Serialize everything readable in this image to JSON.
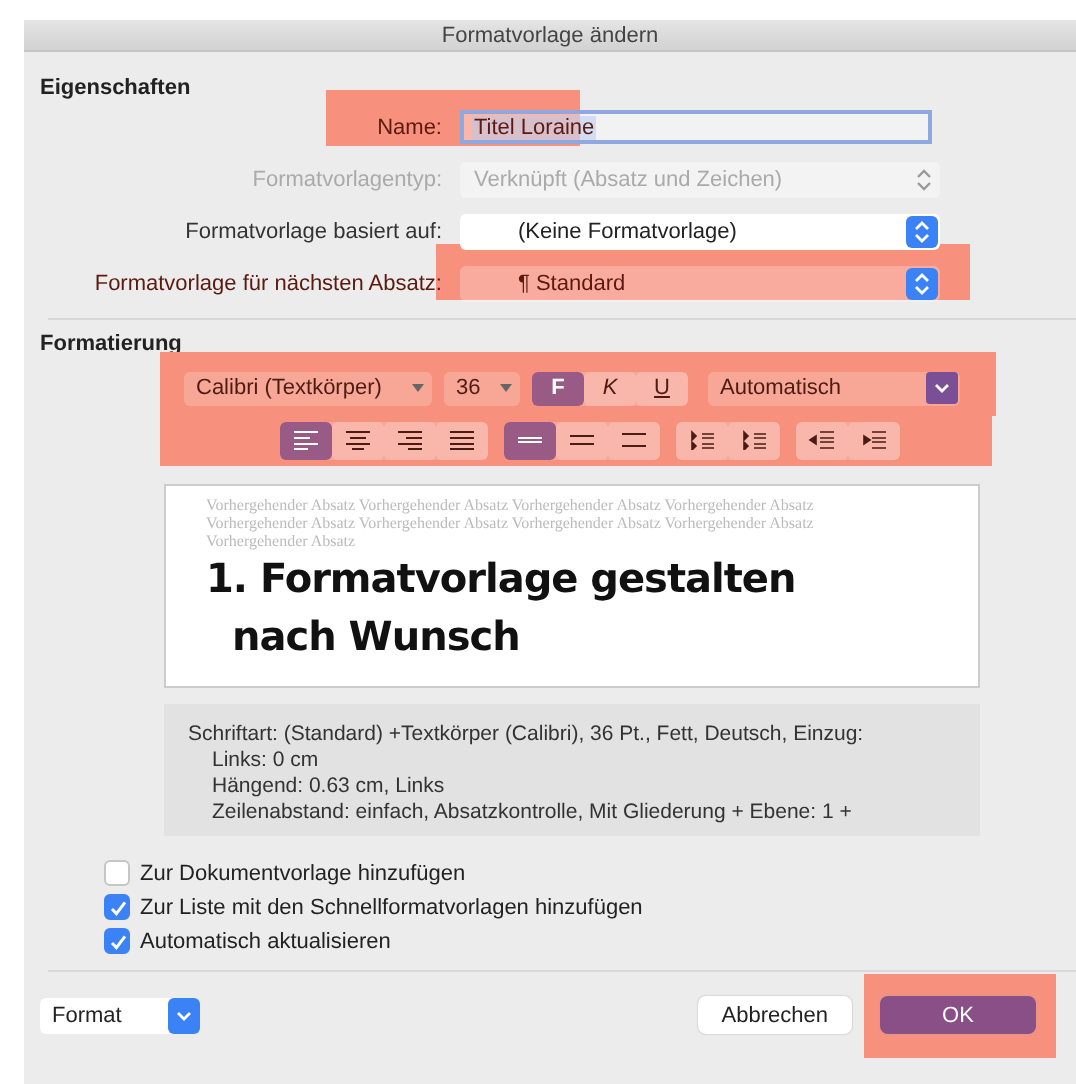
{
  "window": {
    "title": "Formatvorlage ändern"
  },
  "properties": {
    "heading": "Eigenschaften",
    "fields": [
      {
        "kind": "text",
        "label": "Name:",
        "value": "Titel Loraine",
        "disabled": false,
        "highlighted": true
      },
      {
        "kind": "select",
        "label": "Formatvorlagentyp:",
        "value": "Verknüpft (Absatz und Zeichen)",
        "disabled": true,
        "highlighted": false
      },
      {
        "kind": "popup",
        "label": "Formatvorlage basiert auf:",
        "value": "(Keine Formatvorlage)",
        "disabled": false,
        "highlighted": false
      },
      {
        "kind": "popup",
        "label": "Formatvorlage für nächsten Absatz:",
        "value": "¶ Standard",
        "disabled": false,
        "highlighted": true
      }
    ]
  },
  "formatting": {
    "heading": "Formatierung",
    "font_row": {
      "highlighted": true,
      "font": "Calibri (Textkörper)",
      "size": "36",
      "styles": [
        {
          "label": "F",
          "kind": "bold",
          "selected": true
        },
        {
          "label": "K",
          "kind": "italic",
          "selected": false
        },
        {
          "label": "U",
          "kind": "underline",
          "selected": false
        }
      ],
      "color_name": "Automatisch"
    },
    "paragraph_row": {
      "highlighted": true,
      "groups": [
        [
          {
            "kind": "align-left",
            "selected": true
          },
          {
            "kind": "align-center",
            "selected": false
          },
          {
            "kind": "align-right",
            "selected": false
          },
          {
            "kind": "justify",
            "selected": false
          }
        ],
        [
          {
            "kind": "single",
            "selected": true
          },
          {
            "kind": "one-half",
            "selected": false
          },
          {
            "kind": "double",
            "selected": false
          }
        ],
        [
          {
            "kind": "space-before",
            "selected": false
          },
          {
            "kind": "space-after",
            "selected": false
          }
        ],
        [
          {
            "kind": "outdent",
            "selected": false
          },
          {
            "kind": "indent",
            "selected": false
          }
        ]
      ]
    },
    "preview": {
      "previous_text": "Vorhergehender Absatz Vorhergehender Absatz Vorhergehender Absatz Vorhergehender Absatz Vorhergehender Absatz Vorhergehender Absatz Vorhergehender Absatz Vorhergehender Absatz Vorhergehender Absatz",
      "sample_lines": [
        "1. Formatvorlage gestalten",
        "nach Wunsch"
      ]
    },
    "description": [
      "Schriftart: (Standard) +Textkörper (Calibri), 36 Pt., Fett, Deutsch, Einzug:",
      "Links:  0 cm",
      "Hängend:  0.63 cm, Links",
      "Zeilenabstand:  einfach, Absatzkontrolle, Mit Gliederung + Ebene: 1 +"
    ]
  },
  "options": [
    {
      "label": "Zur Dokumentvorlage hinzufügen",
      "checked": false
    },
    {
      "label": "Zur Liste mit den Schnellformatvorlagen hinzufügen",
      "checked": true
    },
    {
      "label": "Automatisch aktualisieren",
      "checked": true
    }
  ],
  "footer": {
    "format_button": "Format",
    "cancel_button": "Abbrechen",
    "ok_button": {
      "label": "OK",
      "highlighted": true
    }
  }
}
